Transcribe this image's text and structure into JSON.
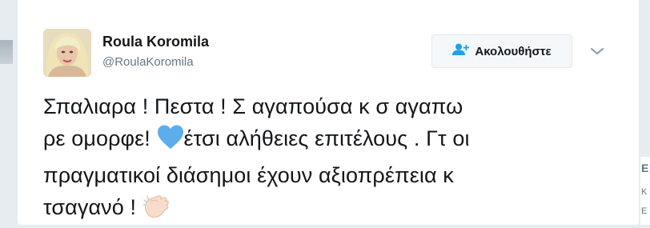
{
  "author": {
    "name": "Roula Koromila",
    "handle": "@RoulaKoromila"
  },
  "follow_button": {
    "label": "Ακολουθήστε",
    "icon": "add-user-icon"
  },
  "menu": {
    "icon": "chevron-down-icon"
  },
  "tweet": {
    "line1": "Σπαλιαρα ! Πεστα ! Σ αγαπούσα κ σ αγαπω",
    "line2_before_emoji": "ρε ομορφε! ",
    "line2_after_emoji": "έτσι αλήθειες επιτέλους . Γτ οι",
    "line3": "πραγματικοί διάσημοι έχουν αξιοπρέπεια κ",
    "line4": "τσαγανό ! ",
    "emojis": [
      "blue-heart-icon",
      "clapping-hands-icon"
    ]
  },
  "colors": {
    "accent": "#1da1f2",
    "text": "#14171a",
    "secondary": "#657786",
    "heart": "#5dadec"
  }
}
